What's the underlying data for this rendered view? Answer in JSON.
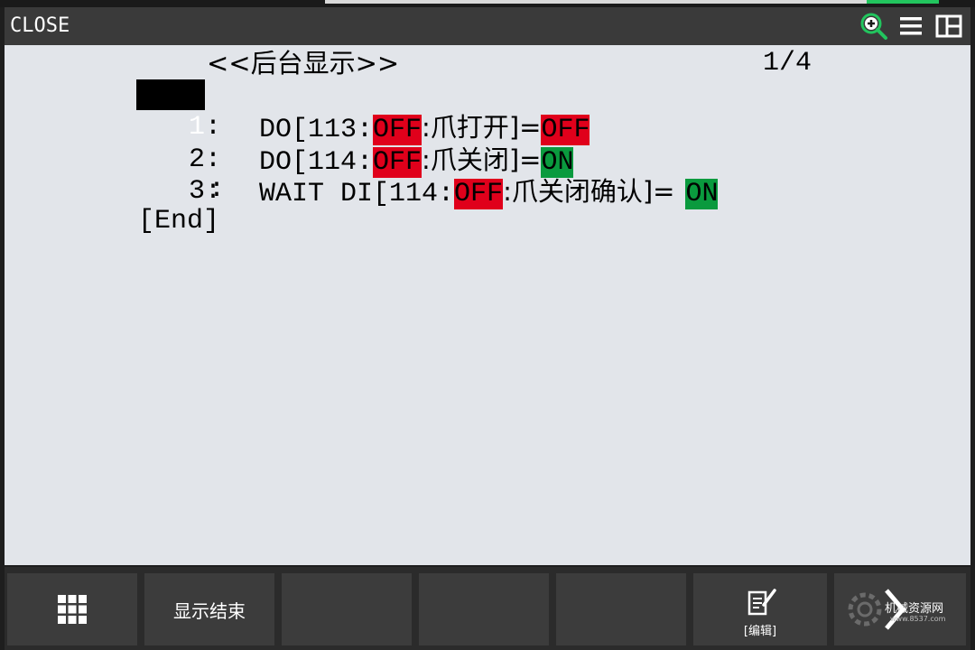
{
  "title_bar": {
    "title": "CLOSE",
    "icons": [
      "zoom-in-icon",
      "menu-icon",
      "split-view-icon"
    ],
    "accent_color": "#22c55e"
  },
  "program": {
    "header": "<<后台显示>>",
    "page_indicator": "1/4",
    "lines": [
      {
        "num": "1",
        "sep": ":",
        "prefix": "DO[113:",
        "state": "OFF",
        "state_color": "#e0001b",
        "comment": ":爪打开]=",
        "value": "OFF",
        "value_color": "#e0001b"
      },
      {
        "num": "2",
        "sep": ":",
        "prefix": "DO[114:",
        "state": "OFF",
        "state_color": "#e0001b",
        "comment": ":爪关闭]=",
        "value": "ON",
        "value_color": "#0a9a3e"
      },
      {
        "num": "3",
        "sep": ":",
        "prefix": "WAIT DI[114:",
        "state": "OFF",
        "state_color": "#e0001b",
        "comment": ":爪关闭确认]=",
        "value": "ON",
        "value_color": "#0a9a3e"
      }
    ],
    "continuation": ":",
    "end_marker": "[End]"
  },
  "function_keys": [
    {
      "label": "",
      "icon": "grid-icon"
    },
    {
      "label": "显示结束"
    },
    {
      "label": ""
    },
    {
      "label": ""
    },
    {
      "label": ""
    },
    {
      "label": "[编辑]",
      "icon": "edit-icon"
    },
    {
      "label": "",
      "icon": "chevron-right-icon"
    }
  ],
  "watermark": {
    "text": "机械资源网",
    "subtext": "www.8537.com"
  }
}
